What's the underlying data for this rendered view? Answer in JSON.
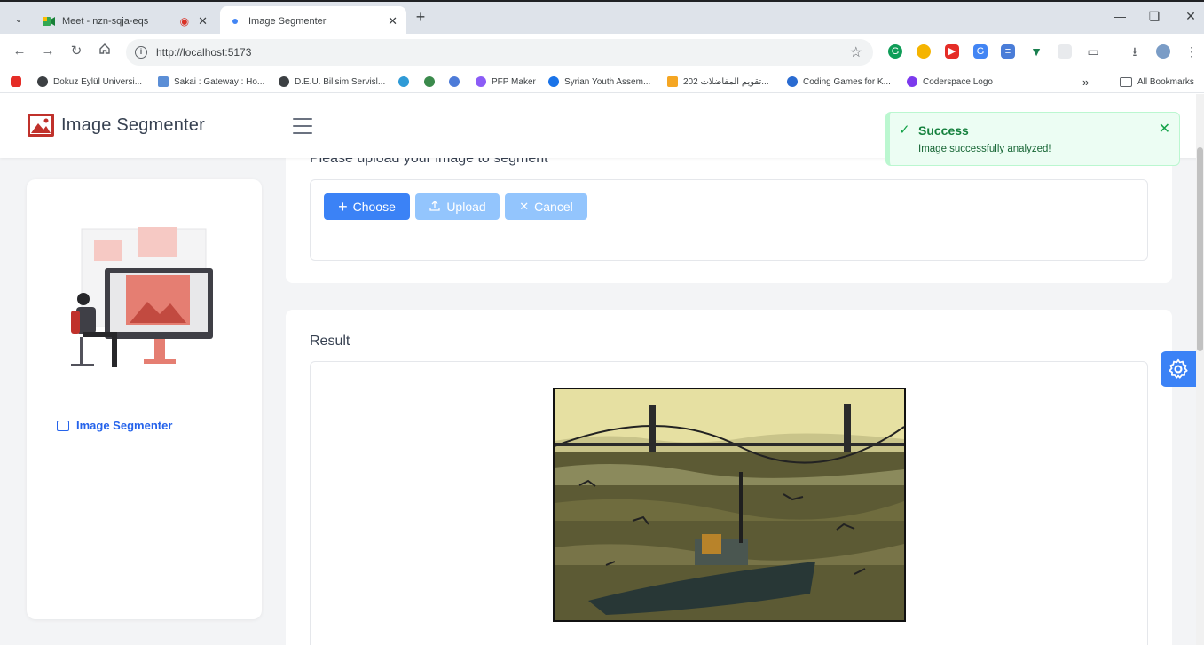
{
  "browser": {
    "tabs": [
      {
        "title": "Meet - nzn-sqja-eqs",
        "active": false,
        "recording": true
      },
      {
        "title": "Image Segmenter",
        "active": true
      }
    ],
    "url": "http://localhost:5173",
    "bookmarks": [
      "Dokuz Eylül Universi...",
      "Sakai : Gateway : Ho...",
      "D.E.U. Bilisim Servisl...",
      "PFP Maker",
      "Syrian Youth Assem...",
      "تقويم المفاضلات 202...",
      "Coding Games for K...",
      "Coderspace Logo"
    ],
    "all_bookmarks": "All Bookmarks"
  },
  "app": {
    "title": "Image Segmenter",
    "upload_heading": "Please upload your image to segment",
    "buttons": {
      "choose": "Choose",
      "upload": "Upload",
      "cancel": "Cancel"
    },
    "result_title": "Result",
    "sidebar": {
      "items": [
        {
          "label": "Image Segmenter",
          "icon": "image-icon"
        }
      ]
    }
  },
  "toast": {
    "title": "Success",
    "message": "Image successfully analyzed!"
  },
  "colors": {
    "primary": "#3b82f6",
    "primary_disabled": "#93c5fd",
    "success_bg": "#ecfdf3",
    "logo": "#c0312b"
  }
}
